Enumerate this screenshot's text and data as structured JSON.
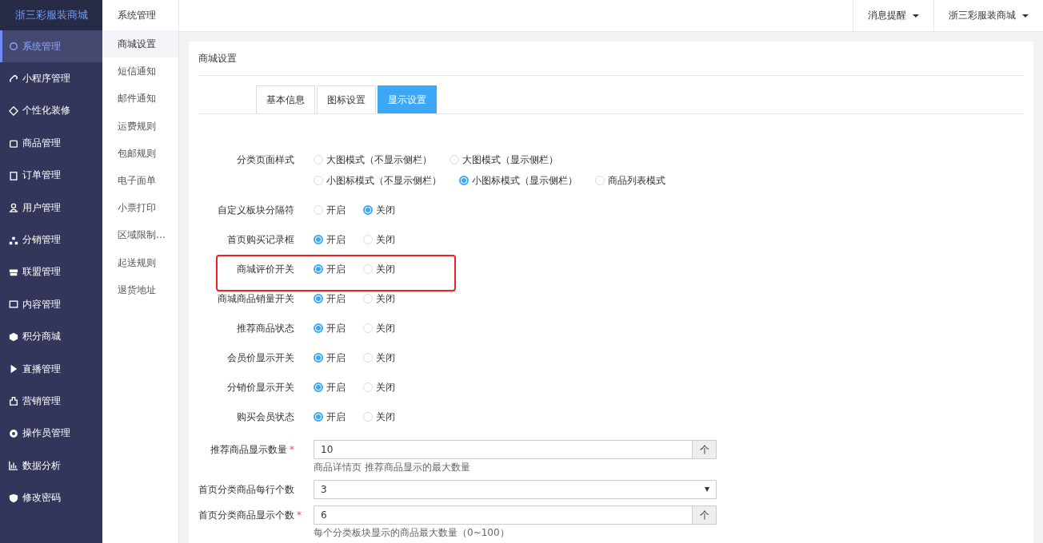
{
  "brand": "浙三彩服装商城",
  "sidebar": {
    "items": [
      {
        "label": "系统管理",
        "selected": true
      },
      {
        "label": "小程序管理",
        "selected": false
      },
      {
        "label": "个性化装修",
        "selected": false
      },
      {
        "label": "商品管理",
        "selected": false
      },
      {
        "label": "订单管理",
        "selected": false
      },
      {
        "label": "用户管理",
        "selected": false
      },
      {
        "label": "分销管理",
        "selected": false
      },
      {
        "label": "联盟管理",
        "selected": false
      },
      {
        "label": "内容管理",
        "selected": false
      },
      {
        "label": "积分商城",
        "selected": false
      },
      {
        "label": "直播管理",
        "selected": false
      },
      {
        "label": "营销管理",
        "selected": false
      },
      {
        "label": "操作员管理",
        "selected": false
      },
      {
        "label": "数据分析",
        "selected": false
      },
      {
        "label": "修改密码",
        "selected": false
      }
    ]
  },
  "submenu": {
    "title": "系统管理",
    "items": [
      {
        "label": "商城设置",
        "selected": true
      },
      {
        "label": "短信通知",
        "selected": false
      },
      {
        "label": "邮件通知",
        "selected": false
      },
      {
        "label": "运费规则",
        "selected": false
      },
      {
        "label": "包邮规则",
        "selected": false
      },
      {
        "label": "电子面单",
        "selected": false
      },
      {
        "label": "小票打印",
        "selected": false
      },
      {
        "label": "区域限制…",
        "selected": false
      },
      {
        "label": "起送规则",
        "selected": false
      },
      {
        "label": "退货地址",
        "selected": false
      }
    ]
  },
  "topbar": {
    "menus": [
      "消息提醒",
      "浙三彩服装商城"
    ]
  },
  "card": {
    "title": "商城设置",
    "tabs": [
      {
        "label": "基本信息",
        "selected": false
      },
      {
        "label": "图标设置",
        "selected": false
      },
      {
        "label": "显示设置",
        "selected": true
      }
    ],
    "rows": [
      {
        "kind": "radio",
        "label": "分类页面样式",
        "highlighted": false,
        "option_lines": [
          [
            {
              "label": "大图模式（不显示侧栏）",
              "selected": false
            },
            {
              "label": "大图模式（显示侧栏）",
              "selected": false
            }
          ],
          [
            {
              "label": "小图标模式（不显示侧栏）",
              "selected": false
            },
            {
              "label": "小图标模式（显示侧栏）",
              "selected": true
            },
            {
              "label": "商品列表模式",
              "selected": false
            }
          ]
        ]
      },
      {
        "kind": "radio",
        "label": "自定义板块分隔符",
        "highlighted": false,
        "option_lines": [
          [
            {
              "label": "开启",
              "selected": false
            },
            {
              "label": "关闭",
              "selected": true
            }
          ]
        ]
      },
      {
        "kind": "radio",
        "label": "首页购买记录框",
        "highlighted": false,
        "option_lines": [
          [
            {
              "label": "开启",
              "selected": true
            },
            {
              "label": "关闭",
              "selected": false
            }
          ]
        ]
      },
      {
        "kind": "radio",
        "label": "商城评价开关",
        "highlighted": true,
        "option_lines": [
          [
            {
              "label": "开启",
              "selected": true
            },
            {
              "label": "关闭",
              "selected": false
            }
          ]
        ]
      },
      {
        "kind": "radio",
        "label": "商城商品销量开关",
        "highlighted": false,
        "option_lines": [
          [
            {
              "label": "开启",
              "selected": true
            },
            {
              "label": "关闭",
              "selected": false
            }
          ]
        ]
      },
      {
        "kind": "radio",
        "label": "推荐商品状态",
        "highlighted": false,
        "option_lines": [
          [
            {
              "label": "开启",
              "selected": true
            },
            {
              "label": "关闭",
              "selected": false
            }
          ]
        ]
      },
      {
        "kind": "radio",
        "label": "会员价显示开关",
        "highlighted": false,
        "option_lines": [
          [
            {
              "label": "开启",
              "selected": true
            },
            {
              "label": "关闭",
              "selected": false
            }
          ]
        ]
      },
      {
        "kind": "radio",
        "label": "分销价显示开关",
        "highlighted": false,
        "option_lines": [
          [
            {
              "label": "开启",
              "selected": true
            },
            {
              "label": "关闭",
              "selected": false
            }
          ]
        ]
      },
      {
        "kind": "radio",
        "label": "购买会员状态",
        "highlighted": false,
        "option_lines": [
          [
            {
              "label": "开启",
              "selected": true
            },
            {
              "label": "关闭",
              "selected": false
            }
          ]
        ]
      },
      {
        "kind": "number",
        "label": "推荐商品显示数量",
        "required_mark": "*",
        "value": "10",
        "unit": "个",
        "help": "商品详情页 推荐商品显示的最大数量"
      },
      {
        "kind": "select",
        "label": "首页分类商品每行个数",
        "value": "3"
      },
      {
        "kind": "number",
        "label": "首页分类商品显示个数",
        "required_mark": "*",
        "value": "6",
        "unit": "个",
        "help": "每个分类板块显示的商品最大数量（0~100）"
      }
    ]
  }
}
